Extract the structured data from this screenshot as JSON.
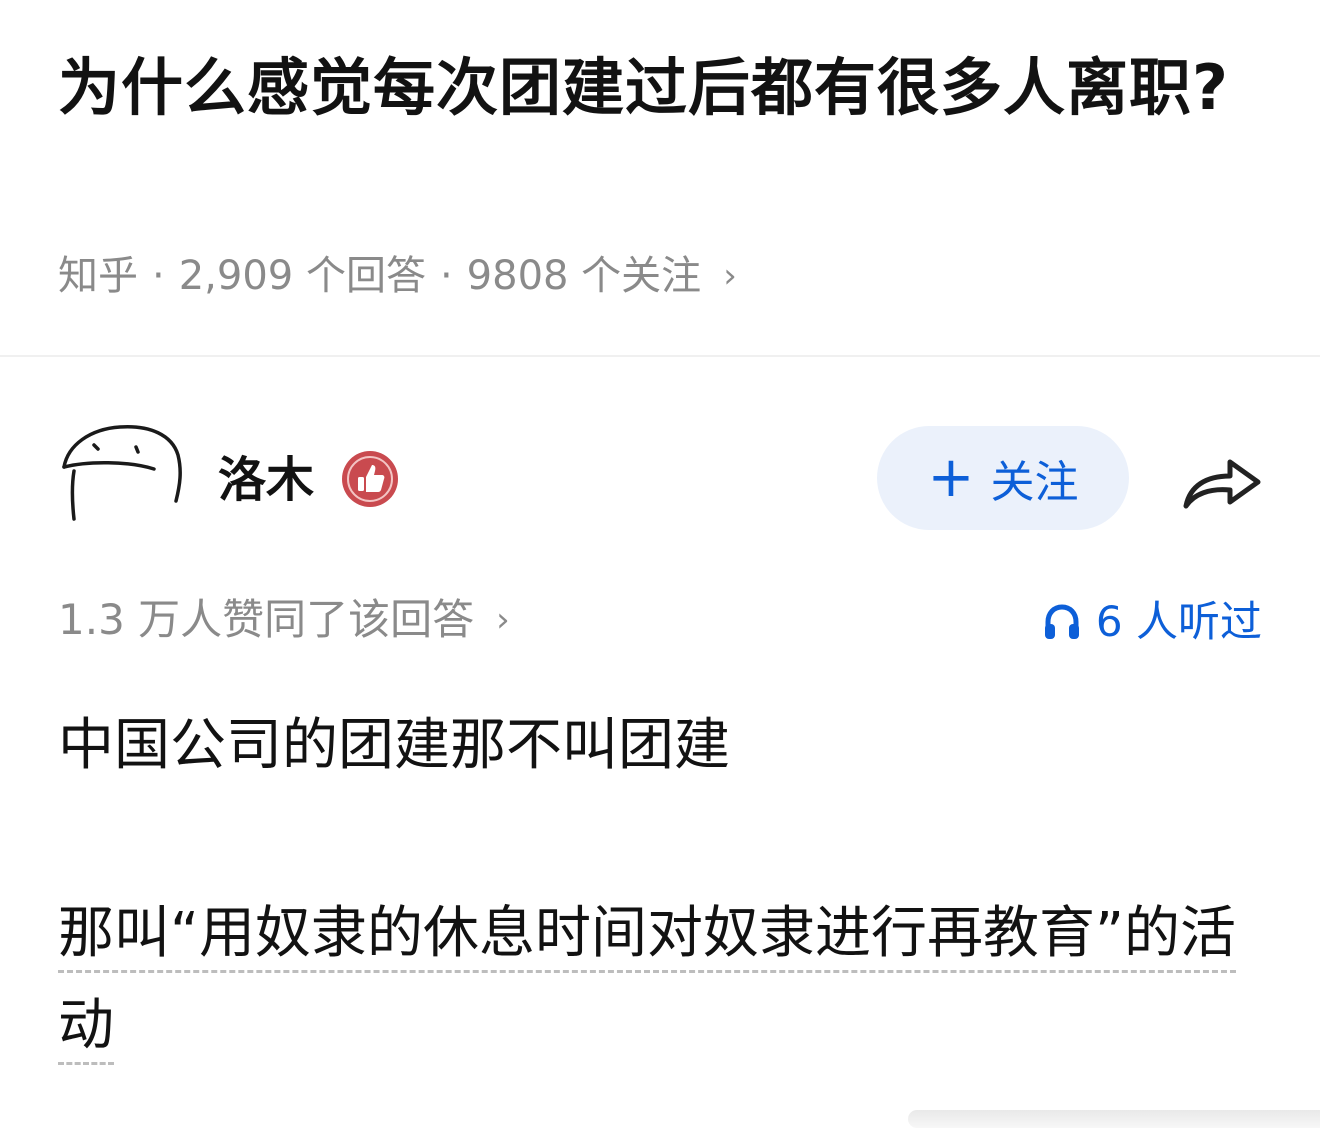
{
  "question": {
    "title": "为什么感觉每次团建过后都有很多人离职?",
    "source": "知乎",
    "answers_count": "2,909 个回答",
    "followers_count": "9808 个关注",
    "chevron": "›"
  },
  "author": {
    "name": "洛木",
    "avatar_icon": "doodle-face-icon",
    "badge_icon": "thumbs-up-badge-icon",
    "badge_color": "#c94a4f"
  },
  "follow_button": {
    "plus": "+",
    "label": "关注"
  },
  "share_icon": "share-arrow-icon",
  "stats": {
    "likes": "1.3 万人赞同了该回答",
    "chevron": "›",
    "listened": "6 人听过",
    "listened_icon": "headphones-icon"
  },
  "answer": {
    "paragraph1": "中国公司的团建那不叫团建",
    "paragraph2": "那叫“用奴隶的休息时间对奴隶进行再教育”的活动"
  },
  "colors": {
    "accent": "#0d5fd8",
    "follow_bg": "#ebf1fb",
    "meta_gray": "#8a8a8a",
    "text": "#121212"
  }
}
